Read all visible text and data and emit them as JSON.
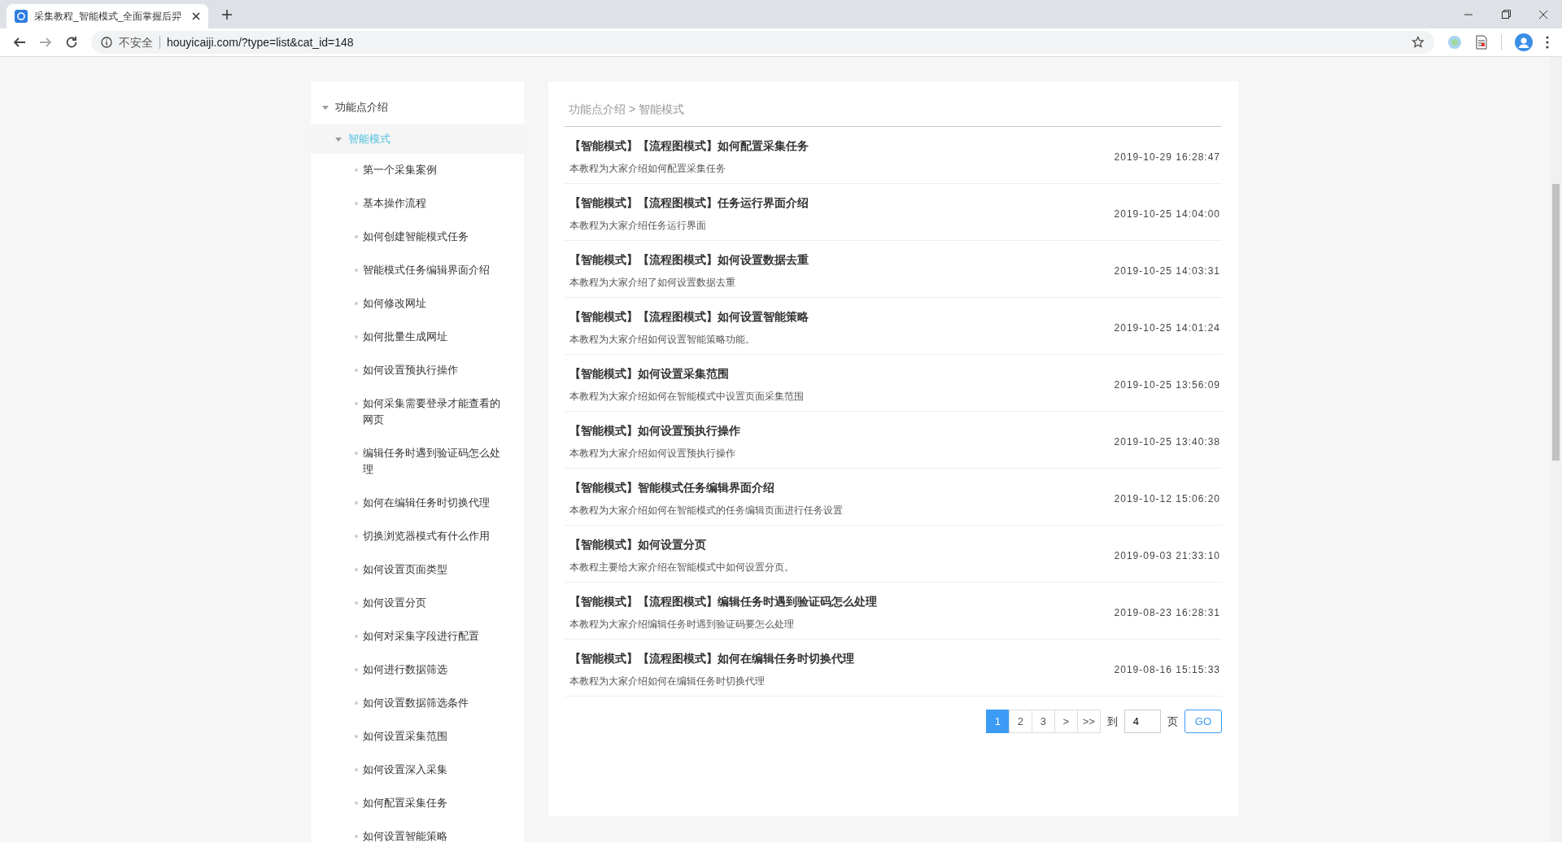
{
  "browser": {
    "tab_title": "采集教程_智能模式_全面掌握后羿",
    "security_label": "不安全",
    "url": "houyicaiji.com/?type=list&cat_id=148"
  },
  "sidebar": {
    "items": [
      {
        "label": "功能点介绍",
        "expanded": true,
        "selected": false,
        "children": [
          {
            "label": "智能模式",
            "expanded": true,
            "selected": true,
            "children": [
              {
                "label": "第一个采集案例",
                "selected": false
              },
              {
                "label": "基本操作流程",
                "selected": false
              },
              {
                "label": "如何创建智能模式任务",
                "selected": false
              },
              {
                "label": "智能模式任务编辑界面介绍",
                "selected": false
              },
              {
                "label": "如何修改网址",
                "selected": false
              },
              {
                "label": "如何批量生成网址",
                "selected": false
              },
              {
                "label": "如何设置预执行操作",
                "selected": false
              },
              {
                "label": "如何采集需要登录才能查看的网页",
                "selected": false
              },
              {
                "label": "编辑任务时遇到验证码怎么处理",
                "selected": false
              },
              {
                "label": "如何在编辑任务时切换代理",
                "selected": false
              },
              {
                "label": "切换浏览器模式有什么作用",
                "selected": false
              },
              {
                "label": "如何设置页面类型",
                "selected": false
              },
              {
                "label": "如何设置分页",
                "selected": false
              },
              {
                "label": "如何对采集字段进行配置",
                "selected": false
              },
              {
                "label": "如何进行数据筛选",
                "selected": false
              },
              {
                "label": "如何设置数据筛选条件",
                "selected": false
              },
              {
                "label": "如何设置采集范围",
                "selected": false
              },
              {
                "label": "如何设置深入采集",
                "selected": false
              },
              {
                "label": "如何配置采集任务",
                "selected": false
              },
              {
                "label": "如何设置智能策略",
                "selected": false
              }
            ]
          }
        ]
      }
    ]
  },
  "breadcrumb": {
    "items": [
      "功能点介绍",
      "智能模式"
    ],
    "separator": ">"
  },
  "articles": [
    {
      "title": "【智能模式】【流程图模式】如何配置采集任务",
      "summary": "本教程为大家介绍如何配置采集任务",
      "date": "2019-10-29 16:28:47"
    },
    {
      "title": "【智能模式】【流程图模式】任务运行界面介绍",
      "summary": "本教程为大家介绍任务运行界面",
      "date": "2019-10-25 14:04:00"
    },
    {
      "title": "【智能模式】【流程图模式】如何设置数据去重",
      "summary": "本教程为大家介绍了如何设置数据去重",
      "date": "2019-10-25 14:03:31"
    },
    {
      "title": "【智能模式】【流程图模式】如何设置智能策略",
      "summary": "本教程为大家介绍如何设置智能策略功能。",
      "date": "2019-10-25 14:01:24"
    },
    {
      "title": "【智能模式】如何设置采集范围",
      "summary": "本教程为大家介绍如何在智能模式中设置页面采集范围",
      "date": "2019-10-25 13:56:09"
    },
    {
      "title": "【智能模式】如何设置预执行操作",
      "summary": "本教程为大家介绍如何设置预执行操作",
      "date": "2019-10-25 13:40:38"
    },
    {
      "title": "【智能模式】智能模式任务编辑界面介绍",
      "summary": "本教程为大家介绍如何在智能模式的任务编辑页面进行任务设置",
      "date": "2019-10-12 15:06:20"
    },
    {
      "title": "【智能模式】如何设置分页",
      "summary": "本教程主要给大家介绍在智能模式中如何设置分页。",
      "date": "2019-09-03 21:33:10"
    },
    {
      "title": "【智能模式】【流程图模式】编辑任务时遇到验证码怎么处理",
      "summary": "本教程为大家介绍编辑任务时遇到验证码要怎么处理",
      "date": "2019-08-23 16:28:31"
    },
    {
      "title": "【智能模式】【流程图模式】如何在编辑任务时切换代理",
      "summary": "本教程为大家介绍如何在编辑任务时切换代理",
      "date": "2019-08-16 15:15:33"
    }
  ],
  "pagination": {
    "pages": [
      {
        "label": "1",
        "selected": true
      },
      {
        "label": "2",
        "selected": false
      },
      {
        "label": "3",
        "selected": false
      }
    ],
    "next": ">",
    "last": ">>",
    "goto_label": "到",
    "page_input": "4",
    "page_suffix": "页",
    "go_button": "GO"
  }
}
